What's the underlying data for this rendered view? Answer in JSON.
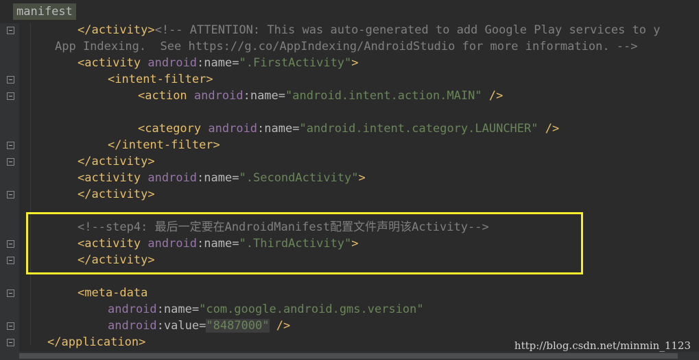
{
  "breadcrumb": {
    "label": "manifest"
  },
  "code": {
    "l1_a": "</activity>",
    "l1_b": "<!-- ATTENTION: This was auto-generated to add Google Play services to y",
    "l2": "App Indexing.  See https://g.co/AppIndexing/AndroidStudio for more information. -->",
    "first_activity": ".FirstActivity",
    "intent_filter": "intent-filter",
    "action": "action",
    "action_main": "android.intent.action.MAIN",
    "category": "category",
    "category_launcher": "android.intent.category.LAUNCHER",
    "second_activity": ".SecondActivity",
    "step_comment": "<!--step4: 最后一定要在AndroidManifest配置文件声明该Activity-->",
    "third_activity": ".ThirdActivity",
    "meta_data": "meta-data",
    "gms_key": "com.google.android.gms.version",
    "gms_value": "8487000",
    "application_close": "application",
    "activity": "activity",
    "android": "android",
    "name": "name",
    "value": "value"
  },
  "watermark": "http://blog.csdn.net/minmin_1123",
  "colors": {
    "background": "#2b2b2b",
    "tag": "#e8bf6a",
    "namespace": "#9876aa",
    "string": "#6a8759",
    "comment": "#808080",
    "highlight_box": "#f8ee2c"
  }
}
